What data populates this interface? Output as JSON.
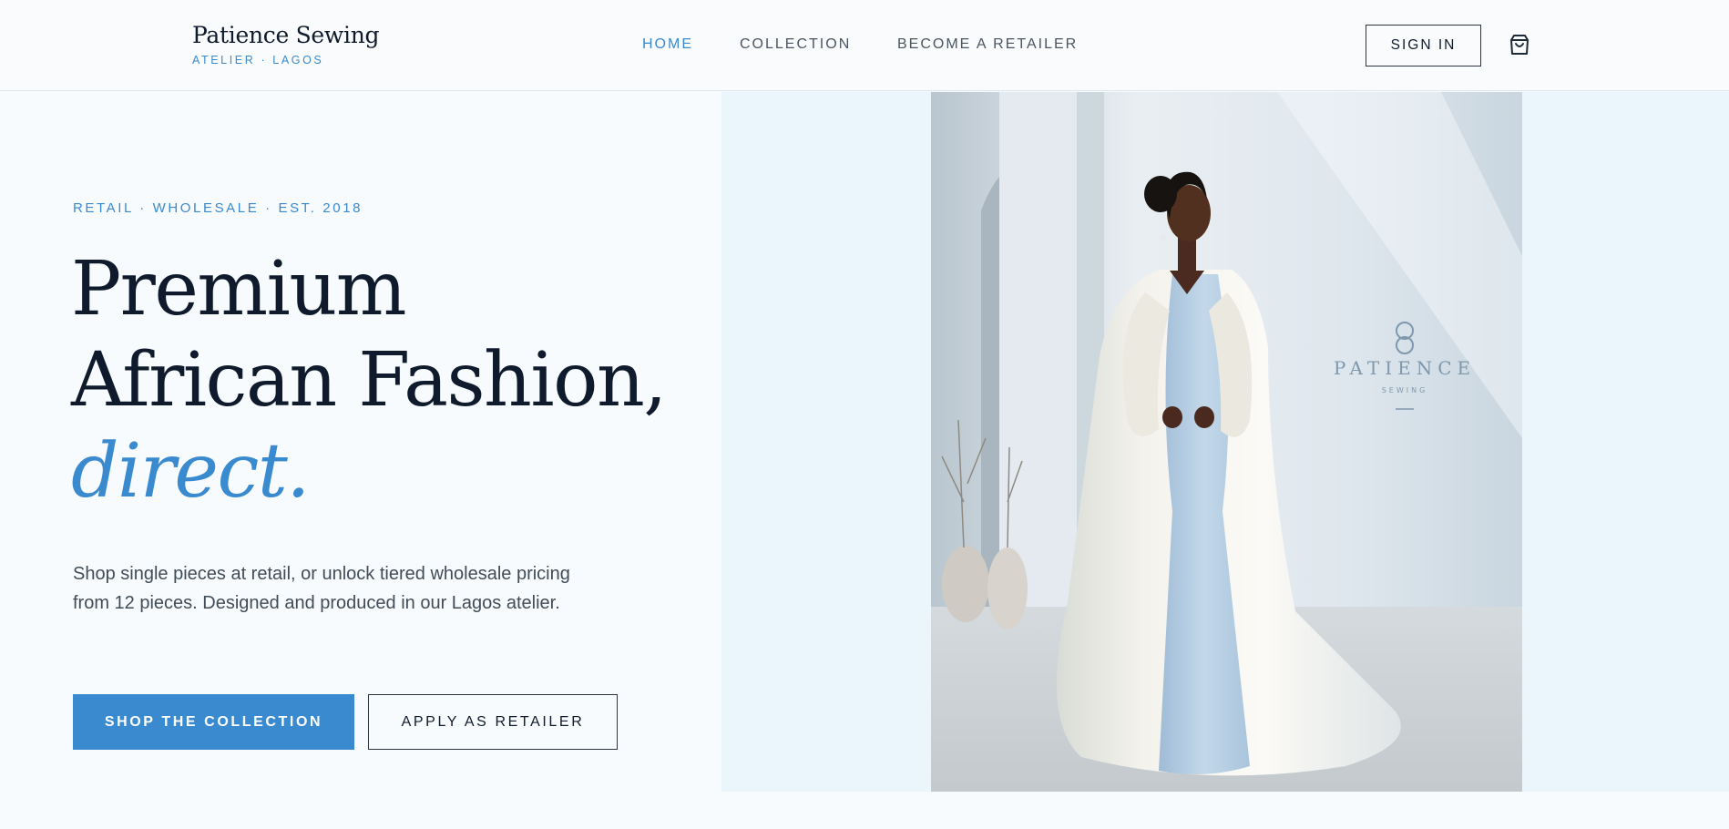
{
  "brand": {
    "name": "Patience Sewing",
    "tagline": "ATELIER · LAGOS"
  },
  "nav": {
    "items": [
      {
        "label": "HOME",
        "active": true
      },
      {
        "label": "COLLECTION",
        "active": false
      },
      {
        "label": "BECOME A RETAILER",
        "active": false
      }
    ],
    "signin_label": "SIGN IN",
    "cart_icon": "shopping-bag-icon"
  },
  "hero": {
    "eyebrow": "RETAIL · WHOLESALE · EST. 2018",
    "headline_line1": "Premium",
    "headline_line2": "African Fashion,",
    "headline_accent": "direct.",
    "lede": "Shop single pieces at retail, or unlock tiered wholesale pricing from 12 pieces. Designed and produced in our Lagos atelier.",
    "primary_cta": "SHOP THE COLLECTION",
    "secondary_cta": "APPLY AS RETAILER"
  },
  "hero_image": {
    "wall_logo_word": "PATIENCE",
    "wall_logo_sub": "SEWING"
  },
  "colors": {
    "accent": "#3a8ad0",
    "ink": "#0f1b2d",
    "panel": "#eaf5fc",
    "page": "#f8fbfd"
  }
}
